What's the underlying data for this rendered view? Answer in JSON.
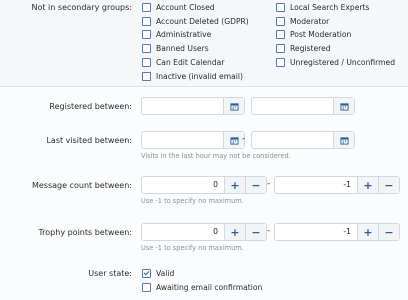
{
  "groups": {
    "label": "Not in secondary groups:",
    "left": [
      {
        "label": "Account Closed",
        "checked": false
      },
      {
        "label": "Account Deleted (GDPR)",
        "checked": false
      },
      {
        "label": "Administrative",
        "checked": false
      },
      {
        "label": "Banned Users",
        "checked": false
      },
      {
        "label": "Can Edit Calendar",
        "checked": false
      },
      {
        "label": "Inactive (invalid email)",
        "checked": false
      }
    ],
    "right": [
      {
        "label": "Local Search Experts",
        "checked": false
      },
      {
        "label": "Moderator",
        "checked": false
      },
      {
        "label": "Post Moderation",
        "checked": false
      },
      {
        "label": "Registered",
        "checked": false
      },
      {
        "label": "Unregistered / Unconfirmed",
        "checked": false
      }
    ]
  },
  "registered": {
    "label": "Registered between:",
    "separator": "-",
    "start_value": "",
    "end_value": ""
  },
  "last_visited": {
    "label": "Last visited between:",
    "separator": "-",
    "start_value": "",
    "end_value": "",
    "hint": "Visits in the last hour may not be considered."
  },
  "message_count": {
    "label": "Message count between:",
    "separator": "-",
    "min": "0",
    "max": "-1",
    "hint": "Use -1 to specify no maximum.",
    "plus": "+",
    "minus": "−"
  },
  "trophy_points": {
    "label": "Trophy points between:",
    "separator": "-",
    "min": "0",
    "max": "-1",
    "hint": "Use -1 to specify no maximum.",
    "plus": "+",
    "minus": "−"
  },
  "user_state": {
    "label": "User state:",
    "options": [
      {
        "label": "Valid",
        "checked": true
      },
      {
        "label": "Awaiting email confirmation",
        "checked": false
      }
    ]
  },
  "colors": {
    "accent": "#2d5fa0",
    "border": "#d2d8de",
    "button_bg": "#f2f5f8",
    "hint": "#8a8f96"
  }
}
